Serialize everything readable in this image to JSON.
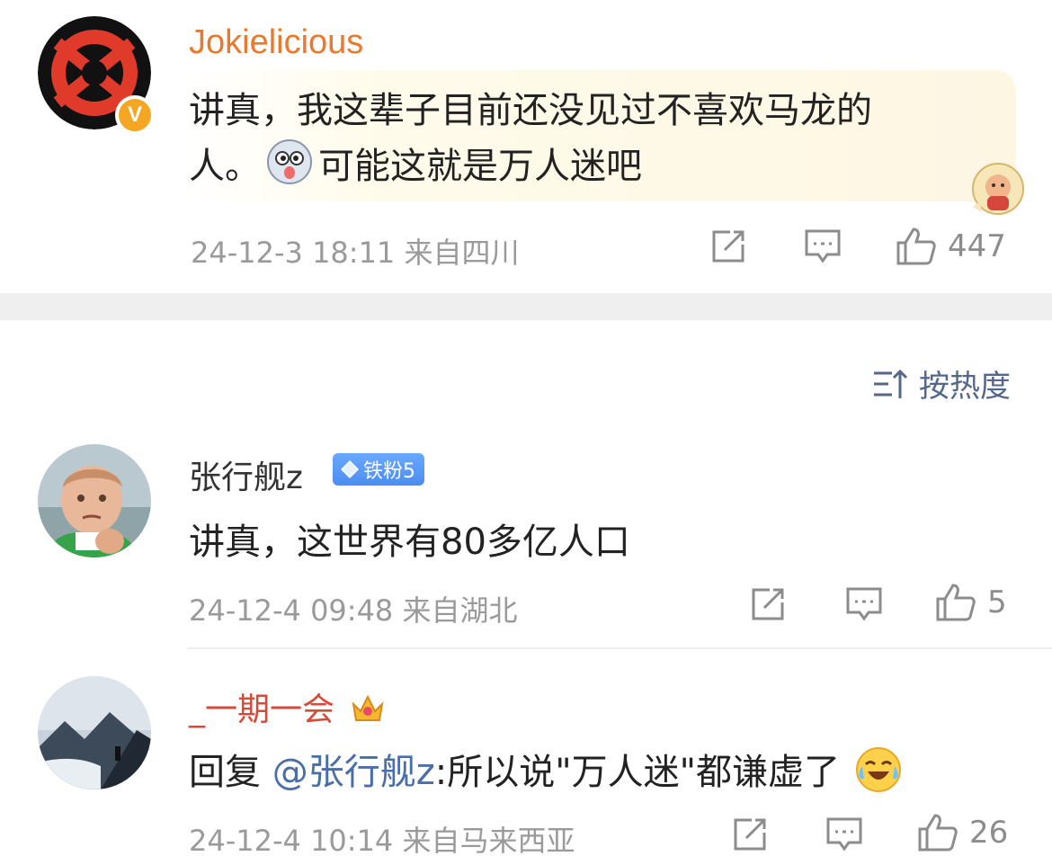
{
  "post": {
    "username": "Jokielicious",
    "verified_badge": "V",
    "text_line1": "讲真，我这辈子目前还没见过不喜欢马龙的",
    "text_line2_prefix": "人。",
    "text_line2_suffix": "可能这就是万人迷吧",
    "inline_emoji": "dog-face-emoji",
    "sticker": "cartoon-character-sticker",
    "meta": "24-12-3 18:11  来自四川",
    "like_count": "447",
    "accent_color": "#e8792e"
  },
  "sort": {
    "label": "按热度",
    "icon": "sort-icon"
  },
  "comments": [
    {
      "username": "张行舰z",
      "badge": "铁粉5",
      "text": "讲真，这世界有80多亿人口",
      "meta": "24-12-4 09:48  来自湖北",
      "like_count": "5"
    },
    {
      "username": "_一期一会",
      "badge_icon": "crown-icon",
      "text_prefix": "回复",
      "mention": "@张行舰z",
      "text_suffix": ":所以说\"万人迷\"都谦虚了",
      "trailing_emoji": "laugh-cry-emoji",
      "meta": "24-12-4 10:14  来自马来西亚",
      "like_count": "26"
    }
  ],
  "colors": {
    "mention": "#4a6ea8",
    "badge_blue": "#4b8df2",
    "separator": "#efefef"
  }
}
